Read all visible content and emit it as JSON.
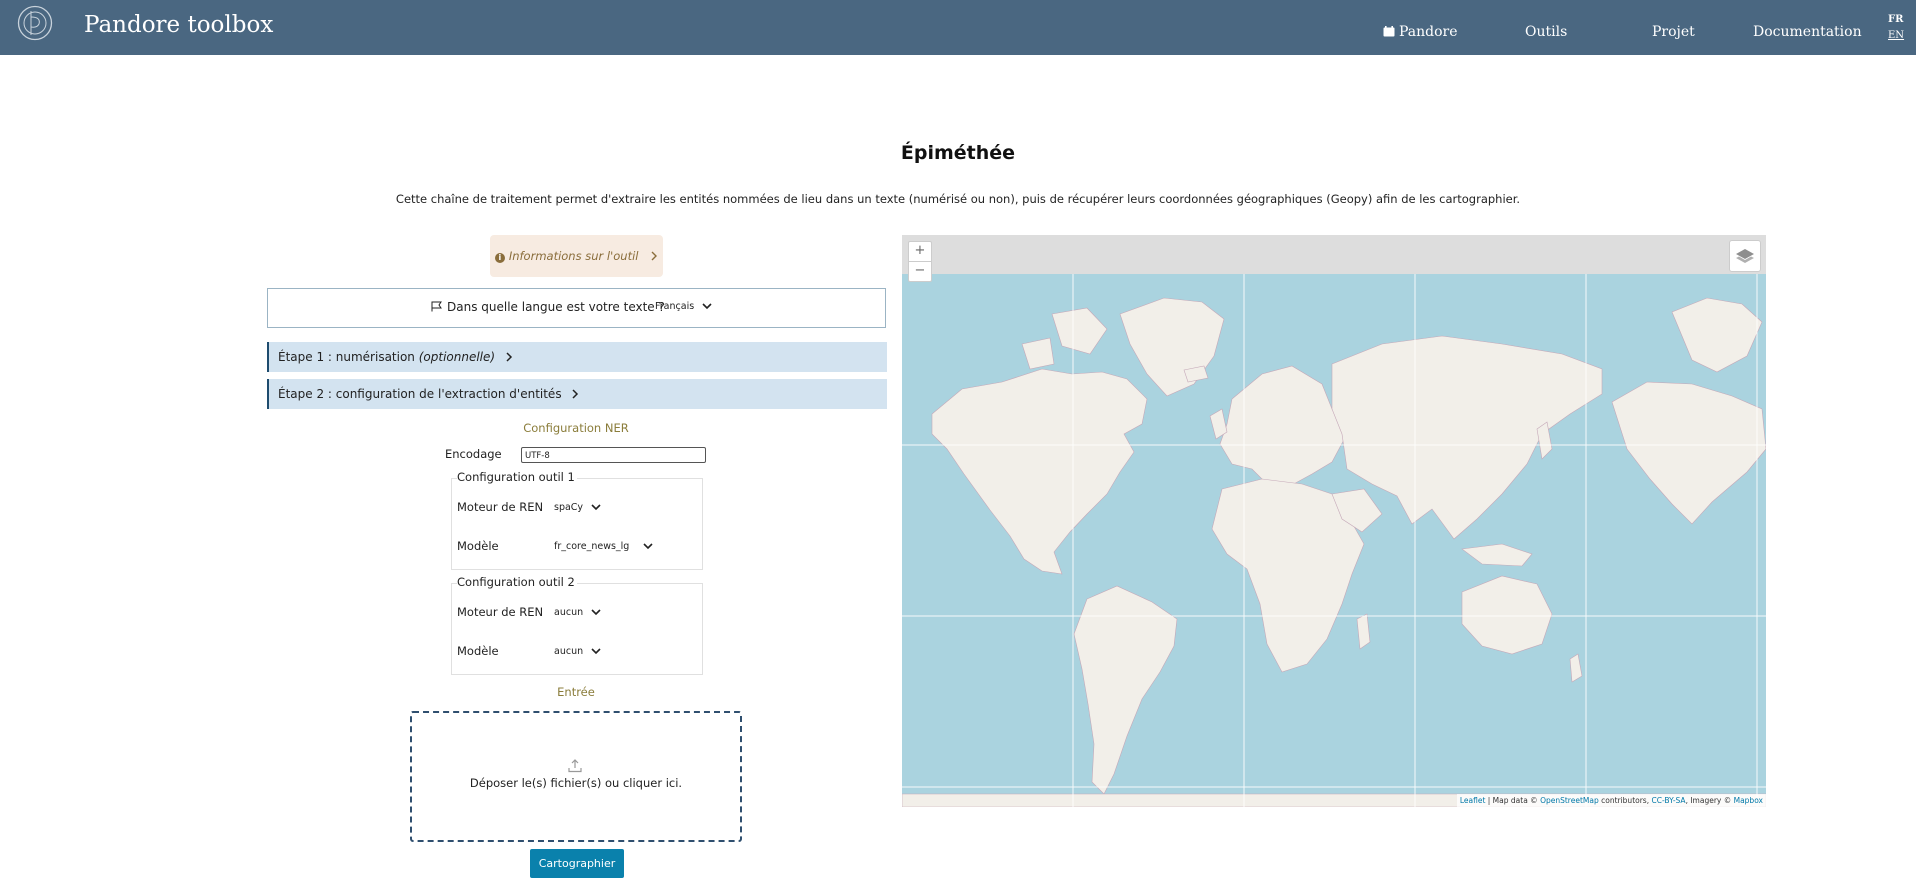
{
  "navbar": {
    "brand": "Pandore toolbox",
    "items": [
      {
        "label": "Pandore",
        "icon": "calendar-icon"
      },
      {
        "label": "Outils"
      },
      {
        "label": "Projet"
      },
      {
        "label": "Documentation"
      }
    ],
    "lang_fr": "FR",
    "lang_en": "EN"
  },
  "main": {
    "title": "Épiméthée",
    "intro": "Cette chaîne de traitement permet d'extraire les entités nommées de lieu dans un texte (numérisé ou non), puis de récupérer leurs coordonnées géographiques (Geopy) afin de les cartographier.",
    "info_button": "Informations sur l'outil",
    "language_question": "Dans quelle langue est votre texte ?",
    "language_value": "Français",
    "step1_label": "Étape 1 : numérisation",
    "step1_optional": "(optionnelle)",
    "step2_label": "Étape 2 : configuration de l'extraction d'entités"
  },
  "ner": {
    "title": "Configuration NER",
    "encoding_label": "Encodage",
    "encoding_value": "UTF-8",
    "tool1": {
      "legend": "Configuration outil 1",
      "engine_label": "Moteur de REN",
      "engine_value": "spaCy",
      "model_label": "Modèle",
      "model_value": "fr_core_news_lg"
    },
    "tool2": {
      "legend": "Configuration outil 2",
      "engine_label": "Moteur de REN",
      "engine_value": "aucun",
      "model_label": "Modèle",
      "model_value": "aucun"
    }
  },
  "input": {
    "title": "Entrée",
    "dropzone_text": "Déposer le(s) fichier(s) ou cliquer ici.",
    "submit": "Cartographier"
  },
  "map": {
    "zoom_in": "+",
    "zoom_out": "−",
    "attribution": {
      "leaflet": "Leaflet",
      "sep1": " | Map data © ",
      "osm": "OpenStreetMap",
      "mid": " contributors, ",
      "license": "CC-BY-SA",
      "imagery": ", Imagery © ",
      "mapbox": "Mapbox"
    }
  },
  "colors": {
    "navbar": "#4a6781",
    "accent": "#0a81ac",
    "step_bg": "#d3e3f0",
    "section_title": "#8b7d3b",
    "ocean": "#aad3df",
    "land": "#f2efe9"
  }
}
